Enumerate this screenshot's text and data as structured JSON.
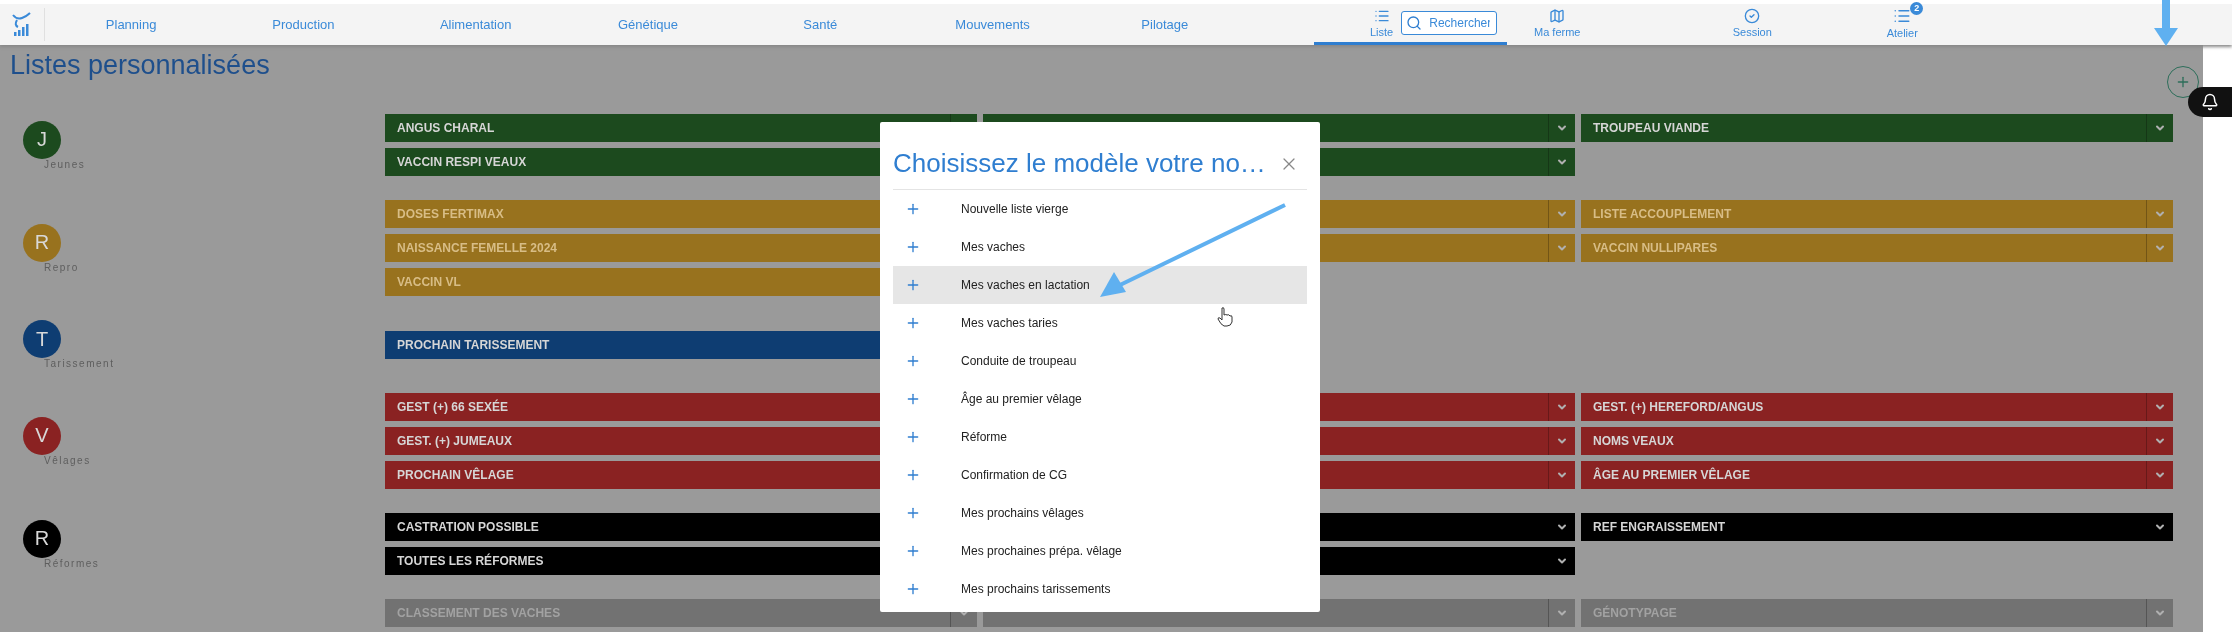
{
  "nav": {
    "links": [
      "Planning",
      "Production",
      "Alimentation",
      "Génétique",
      "Santé",
      "Mouvements",
      "Pilotage"
    ],
    "tabs": [
      {
        "kind": "list",
        "label": "Liste",
        "selected": true
      },
      {
        "kind": "map",
        "label": "Ma ferme",
        "selected": false
      },
      {
        "kind": "session",
        "label": "Session",
        "selected": false
      },
      {
        "kind": "workshop",
        "label": "Atelier",
        "selected": false,
        "badge": "2"
      }
    ],
    "search": {
      "placeholder": "Rechercher"
    }
  },
  "page": {
    "title": "Listes personnalisées"
  },
  "groups": [
    {
      "letter": "J",
      "name": "Jeunes",
      "color": "#1c4a1e",
      "lists": [
        {
          "kind": "list",
          "label": "ANGUS CHARAL"
        },
        {
          "kind": "covered"
        },
        {
          "kind": "list",
          "label": "TROUPEAU VIANDE"
        },
        {
          "kind": "list",
          "label": "VACCIN RESPI VEAUX"
        },
        {
          "kind": "covered"
        }
      ]
    },
    {
      "letter": "R",
      "name": "Repro",
      "color": "#98721e",
      "lists": [
        {
          "kind": "list",
          "label": "DOSES FERTIMAX"
        },
        {
          "kind": "covered"
        },
        {
          "kind": "list",
          "label": "LISTE ACCOUPLEMENT"
        },
        {
          "kind": "list",
          "label": "NAISSANCE FEMELLE 2024"
        },
        {
          "kind": "covered"
        },
        {
          "kind": "list",
          "label": "VACCIN NULLIPARES"
        },
        {
          "kind": "list",
          "label": "VACCIN VL"
        }
      ]
    },
    {
      "letter": "T",
      "name": "Tarissement",
      "color": "#0e3d72",
      "lists": [
        {
          "kind": "list",
          "label": "PROCHAIN TARISSEMENT"
        }
      ]
    },
    {
      "letter": "V",
      "name": "Vêlages",
      "color": "#8a2222",
      "lists": [
        {
          "kind": "list",
          "label": "GEST (+) 66 SEXÉE"
        },
        {
          "kind": "covered"
        },
        {
          "kind": "list",
          "label": "GEST. (+) HEREFORD/ANGUS"
        },
        {
          "kind": "list",
          "label": "GEST. (+) JUMEAUX"
        },
        {
          "kind": "covered"
        },
        {
          "kind": "list",
          "label": "NOMS VEAUX"
        },
        {
          "kind": "list",
          "label": "PROCHAIN VÊLAGE"
        },
        {
          "kind": "covered"
        },
        {
          "kind": "list",
          "label": "ÂGE AU PREMIER VÊLAGE"
        }
      ]
    },
    {
      "letter": "R",
      "name": "Réformes",
      "color": "#000000",
      "lists": [
        {
          "kind": "list",
          "label": "CASTRATION POSSIBLE"
        },
        {
          "kind": "covered"
        },
        {
          "kind": "list",
          "label": "REF ENGRAISSEMENT"
        },
        {
          "kind": "list",
          "label": "TOUTES LES RÉFORMES"
        },
        {
          "kind": "covered"
        }
      ]
    },
    {
      "color": "#727272",
      "lists": [
        {
          "kind": "list",
          "label": "CLASSEMENT DES VACHES"
        },
        {
          "kind": "covered"
        },
        {
          "kind": "list",
          "label": "GÉNOTYPAGE"
        }
      ]
    }
  ],
  "modal": {
    "title": "Choisissez le modèle votre no…",
    "items": [
      {
        "label": "Nouvelle liste vierge",
        "selected": false
      },
      {
        "label": "Mes vaches",
        "selected": false
      },
      {
        "label": "Mes vaches en lactation",
        "selected": true
      },
      {
        "label": "Mes vaches taries",
        "selected": false
      },
      {
        "label": "Conduite de troupeau",
        "selected": false
      },
      {
        "label": "Âge au premier vêlage",
        "selected": false
      },
      {
        "label": "Réforme",
        "selected": false
      },
      {
        "label": "Confirmation de CG",
        "selected": false
      },
      {
        "label": "Mes prochains vêlages",
        "selected": false
      },
      {
        "label": "Mes prochaines prépa. vêlage",
        "selected": false
      },
      {
        "label": "Mes prochains tarissements",
        "selected": false
      }
    ]
  }
}
